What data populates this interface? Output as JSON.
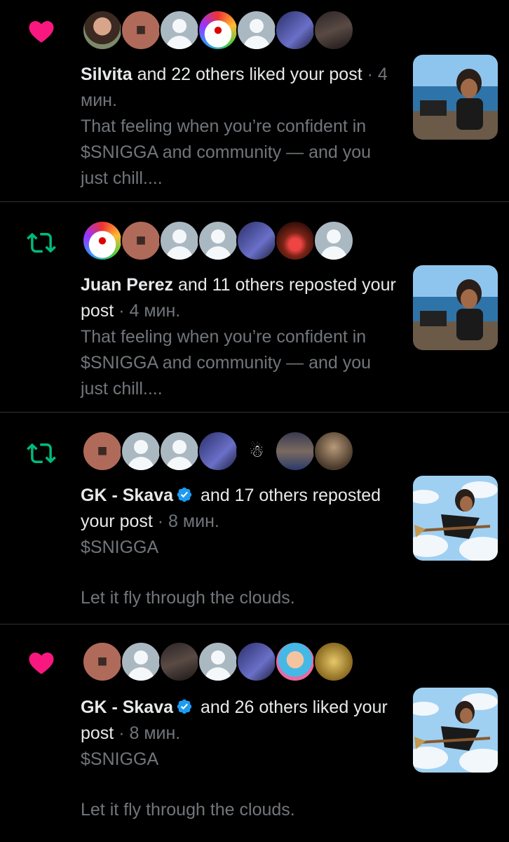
{
  "notifications": [
    {
      "type": "like",
      "icon": "heart-icon",
      "name": "Silvita",
      "action": " and 22 others liked your post",
      "time": " · 4 мин.",
      "snippet": "That feeling when you’re confident in $SNIGGA and community — and you just chill....",
      "verified": false
    },
    {
      "type": "repost",
      "icon": "repost-icon",
      "name": "Juan Perez",
      "action": " and 11 others reposted your post",
      "time": " · 4 мин.",
      "snippet": "That feeling when you’re confident in $SNIGGA and community — and you just chill....",
      "verified": false
    },
    {
      "type": "repost",
      "icon": "repost-icon",
      "name": "GK - Skava",
      "action": " and 17 others reposted your post",
      "time": " · 8 мин.",
      "snippet_line1": "$SNIGGA",
      "snippet_line2": "Let it fly through the clouds.",
      "verified": true
    },
    {
      "type": "like",
      "icon": "heart-icon",
      "name": "GK - Skava",
      "action": " and 26 others liked your post",
      "time": " · 8 мин.",
      "snippet_line1": "$SNIGGA",
      "snippet_line2": "Let it fly through the clouds.",
      "verified": true
    }
  ],
  "colors": {
    "like": "#f91880",
    "repost": "#00ba7c",
    "verified": "#1d9bf0",
    "muted": "#71767b",
    "divider": "#2f3336"
  }
}
